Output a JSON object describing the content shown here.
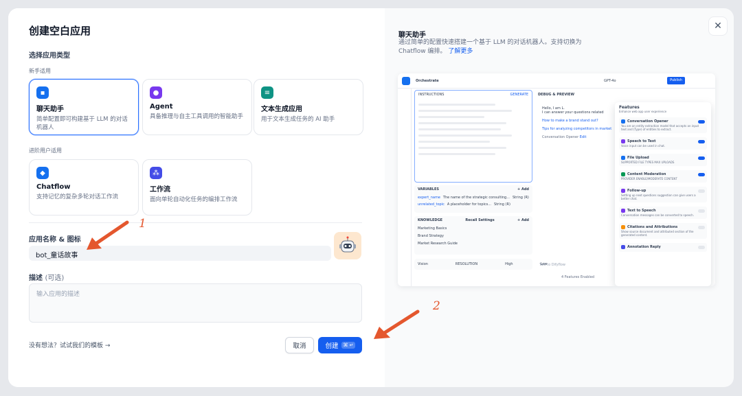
{
  "dialog": {
    "title": "创建空白应用",
    "app_type_label": "选择应用类型",
    "beginner_label": "新手适用",
    "advanced_label": "进阶用户适用",
    "types": [
      {
        "name": "聊天助手",
        "desc": "简单配置即可构建基于 LLM 的对话机器人",
        "color": "#1570ef",
        "icon": "chat-icon"
      },
      {
        "name": "Agent",
        "desc": "具备推理与自主工具调用的智能助手",
        "color": "#7839ee",
        "icon": "agent-icon"
      },
      {
        "name": "文本生成应用",
        "desc": "用于文本生成任务的 AI 助手",
        "color": "#0e9384",
        "icon": "text-generation-icon"
      },
      {
        "name": "Chatflow",
        "desc": "支持记忆的复杂多轮对话工作流",
        "color": "#1570ef",
        "icon": "chatflow-icon"
      },
      {
        "name": "工作流",
        "desc": "面向单轮自动化任务的编排工作流",
        "color": "#444ce7",
        "icon": "workflow-icon"
      }
    ],
    "name_label": "应用名称 & 图标",
    "name_value": "bot_童话故事",
    "desc_label": "描述",
    "desc_optional": "(可选)",
    "desc_placeholder": "输入应用的描述",
    "template_link": "没有想法？试试我们的模板 →",
    "cancel": "取消",
    "create": "创建",
    "create_kbd": "⌘ ↵"
  },
  "preview": {
    "title": "聊天助手",
    "desc": "通过简单的配置快速搭建一个基于 LLM 的对话机器人。支持切换为 Chatflow 编排。",
    "learn_more": "了解更多",
    "orchestrate": "Orchestrate",
    "model": "GPT-4o",
    "publish": "Publish",
    "instructions": "INSTRUCTIONS",
    "generate": "GENERATE",
    "debug": "DEBUG & PREVIEW",
    "greeting": "Hello, I am L.",
    "greeting2": "I can answer your questions related",
    "q1": "How to make a brand stand out?",
    "q2": "Tips for analyzing competitors in market",
    "conv_opener": "Conversation Opener",
    "edit": "Edit",
    "variables": "VARIABLES",
    "add": "+ Add",
    "vars": [
      {
        "name": "expert_name",
        "desc": "The name of the strategic consulting...",
        "type": "String (R)"
      },
      {
        "name": "unrelated_topic",
        "desc": "A placeholder for topics...",
        "type": "String (R)"
      }
    ],
    "knowledge": "KNOWLEDGE",
    "recall": "Recall Settings",
    "kb": [
      "Marketing Basics",
      "Brand Strategy",
      "Market Research Guide"
    ],
    "vision": "Vision",
    "resolution": "RESOLUTION",
    "high": "High",
    "low": "Low",
    "talk": "Talk to Difyflow",
    "features_enabled": "4 Features Enabled",
    "features_title": "Features",
    "features_sub": "Enhance web app user experience",
    "features": [
      {
        "name": "Conversation Opener",
        "desc": "You are an entity extraction model that accepts an input text and (Type) of entities to extract.",
        "color": "#1570ef",
        "on": true
      },
      {
        "name": "Speech to Text",
        "desc": "Voice input can be used in chat.",
        "color": "#7839ee",
        "on": true
      },
      {
        "name": "File Upload",
        "desc": "SUPPORTED FILE TYPES   MAX UPLOADS",
        "color": "#1570ef",
        "on": true
      },
      {
        "name": "Content Moderation",
        "desc": "PROVIDER   ENABLE/MODERATE CONTENT",
        "color": "#039855",
        "on": true
      },
      {
        "name": "Follow-up",
        "desc": "Setting up next questions suggestion can give users a better chat.",
        "color": "#7839ee",
        "on": false
      },
      {
        "name": "Text to Speech",
        "desc": "Conversation messages can be converted to speech.",
        "color": "#7839ee",
        "on": false
      },
      {
        "name": "Citations and Attributions",
        "desc": "Show source document and attributed section of the generated content.",
        "color": "#f79009",
        "on": false
      },
      {
        "name": "Annotation Reply",
        "desc": "",
        "color": "#444ce7",
        "on": false
      }
    ]
  },
  "annotations": {
    "n1": "1",
    "n2": "2"
  },
  "colors": {
    "primary": "#155eef",
    "arrow": "#e4572e"
  }
}
